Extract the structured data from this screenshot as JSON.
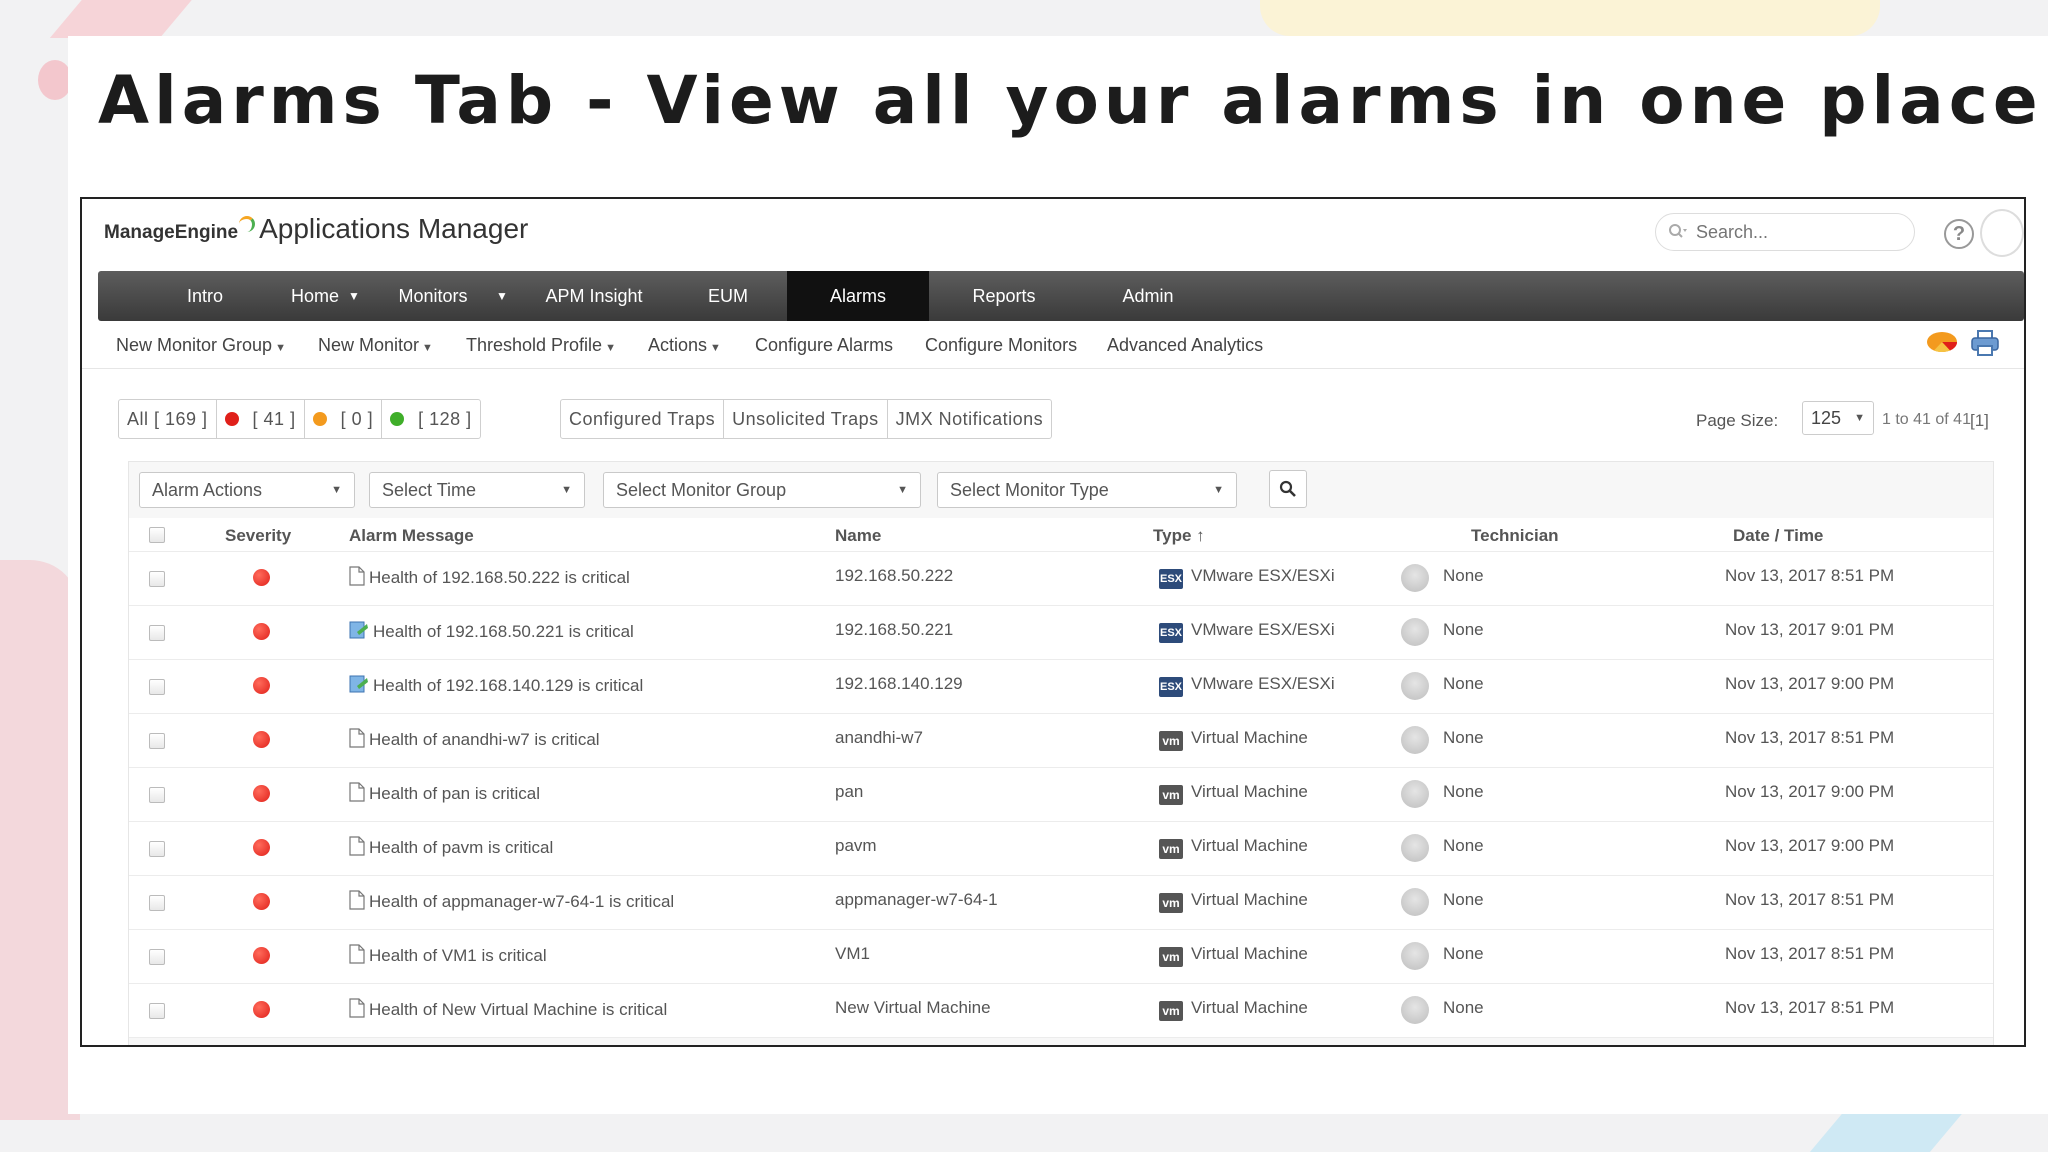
{
  "slide": {
    "title": "Alarms Tab - View all your alarms in one place"
  },
  "header": {
    "brand_company": "ManageEngine",
    "brand_product": "Applications Manager",
    "search_placeholder": "Search...",
    "help": "?"
  },
  "nav": {
    "items": [
      {
        "label": "Intro"
      },
      {
        "label": "Home"
      },
      {
        "label": "Monitors"
      },
      {
        "label": "APM Insight"
      },
      {
        "label": "EUM"
      },
      {
        "label": "Alarms"
      },
      {
        "label": "Reports"
      },
      {
        "label": "Admin"
      }
    ],
    "active": "Alarms"
  },
  "subnav": {
    "items": [
      {
        "label": "New Monitor Group"
      },
      {
        "label": "New Monitor"
      },
      {
        "label": "Threshold Profile"
      },
      {
        "label": "Actions"
      },
      {
        "label": "Configure Alarms"
      },
      {
        "label": "Configure Monitors"
      },
      {
        "label": "Advanced Analytics"
      }
    ]
  },
  "filters": {
    "all": "All [ 169 ]",
    "critical": "[ 41 ]",
    "warning": "[ 0 ]",
    "clear": "[ 128 ]",
    "configured_traps": "Configured Traps",
    "unsolicited_traps": "Unsolicited Traps",
    "jmx": "JMX Notifications"
  },
  "colors": {
    "critical": "#e0201a",
    "warning": "#f39a1e",
    "clear": "#3fae29",
    "nav_active": "#111111"
  },
  "paging": {
    "page_size_label": "Page Size:",
    "page_size": "125",
    "range": "1 to 41 of 41",
    "current": "[1]"
  },
  "toolbar": {
    "alarm_actions": "Alarm Actions",
    "select_time": "Select Time",
    "select_monitor_group": "Select Monitor Group",
    "select_monitor_type": "Select Monitor Type"
  },
  "table": {
    "headers": {
      "severity": "Severity",
      "message": "Alarm Message",
      "name": "Name",
      "type": "Type",
      "sort_indicator": "↑",
      "technician": "Technician",
      "datetime": "Date / Time"
    },
    "rows": [
      {
        "message": "Health of 192.168.50.222 is critical",
        "name": "192.168.50.222",
        "type": "VMware ESX/ESXi",
        "type_icon": "ESX",
        "msg_icon": "document-icon",
        "technician": "None",
        "datetime": "Nov 13, 2017 8:51 PM"
      },
      {
        "message": "Health of 192.168.50.221 is critical",
        "name": "192.168.50.221",
        "type": "VMware ESX/ESXi",
        "type_icon": "ESX",
        "msg_icon": "annotated-document-icon",
        "technician": "None",
        "datetime": "Nov 13, 2017 9:01 PM"
      },
      {
        "message": "Health of 192.168.140.129 is critical",
        "name": "192.168.140.129",
        "type": "VMware ESX/ESXi",
        "type_icon": "ESX",
        "msg_icon": "annotated-document-icon",
        "technician": "None",
        "datetime": "Nov 13, 2017 9:00 PM"
      },
      {
        "message": "Health of anandhi-w7 is critical",
        "name": "anandhi-w7",
        "type": "Virtual Machine",
        "type_icon": "vm",
        "msg_icon": "document-icon",
        "technician": "None",
        "datetime": "Nov 13, 2017 8:51 PM"
      },
      {
        "message": "Health of pan is critical",
        "name": "pan",
        "type": "Virtual Machine",
        "type_icon": "vm",
        "msg_icon": "document-icon",
        "technician": "None",
        "datetime": "Nov 13, 2017 9:00 PM"
      },
      {
        "message": "Health of pavm is critical",
        "name": "pavm",
        "type": "Virtual Machine",
        "type_icon": "vm",
        "msg_icon": "document-icon",
        "technician": "None",
        "datetime": "Nov 13, 2017 9:00 PM"
      },
      {
        "message": "Health of appmanager-w7-64-1 is critical",
        "name": "appmanager-w7-64-1",
        "type": "Virtual Machine",
        "type_icon": "vm",
        "msg_icon": "document-icon",
        "technician": "None",
        "datetime": "Nov 13, 2017 8:51 PM"
      },
      {
        "message": "Health of VM1 is critical",
        "name": "VM1",
        "type": "Virtual Machine",
        "type_icon": "vm",
        "msg_icon": "document-icon",
        "technician": "None",
        "datetime": "Nov 13, 2017 8:51 PM"
      },
      {
        "message": "Health of New Virtual Machine is critical",
        "name": "New Virtual Machine",
        "type": "Virtual Machine",
        "type_icon": "vm",
        "msg_icon": "document-icon",
        "technician": "None",
        "datetime": "Nov 13, 2017 8:51 PM"
      }
    ]
  }
}
